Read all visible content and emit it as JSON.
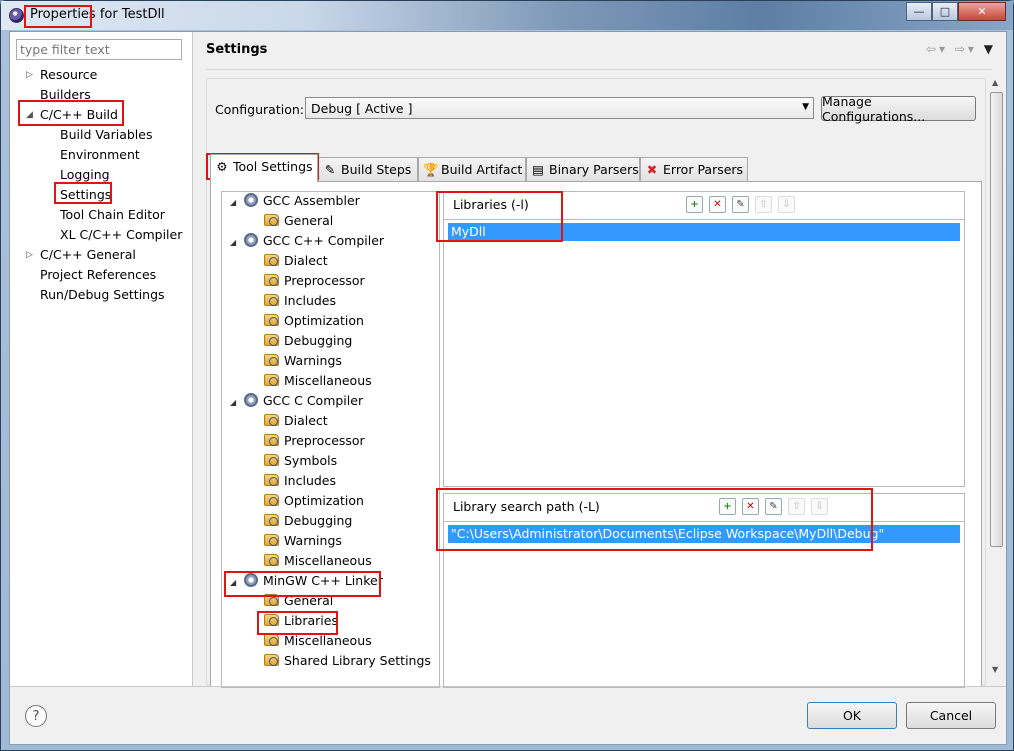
{
  "window": {
    "title": "Properties for TestDll",
    "controls": {
      "minimize": "—",
      "maximize": "□",
      "close": "✕"
    }
  },
  "left_tree": {
    "filter_placeholder": "type filter text",
    "items": [
      {
        "label": "Resource",
        "expander": "▷"
      },
      {
        "label": "Builders"
      },
      {
        "label": "C/C++ Build",
        "expander": "◢"
      },
      {
        "label": "Build Variables"
      },
      {
        "label": "Environment"
      },
      {
        "label": "Logging"
      },
      {
        "label": "Settings"
      },
      {
        "label": "Tool Chain Editor"
      },
      {
        "label": "XL C/C++ Compiler"
      },
      {
        "label": "C/C++ General",
        "expander": "▷"
      },
      {
        "label": "Project References"
      },
      {
        "label": "Run/Debug Settings"
      }
    ]
  },
  "header": {
    "title": "Settings",
    "nav_icons": {
      "back": "⇦",
      "menu1": "▾",
      "forward": "⇨",
      "menu2": "▾",
      "view_menu": "▼"
    }
  },
  "configuration": {
    "label": "Configuration:",
    "value": "Debug  [ Active ]",
    "manage_button": "Manage Configurations..."
  },
  "tabs": [
    {
      "label": "Tool Settings",
      "icon": "⚙"
    },
    {
      "label": "Build Steps",
      "icon": "✎"
    },
    {
      "label": "Build Artifact",
      "icon": "🏆"
    },
    {
      "label": "Binary Parsers",
      "icon": "▤"
    },
    {
      "label": "Error Parsers",
      "icon": "✖"
    }
  ],
  "tool_tree": {
    "groups": [
      {
        "label": "GCC Assembler",
        "children": [
          "General"
        ]
      },
      {
        "label": "GCC C++ Compiler",
        "children": [
          "Dialect",
          "Preprocessor",
          "Includes",
          "Optimization",
          "Debugging",
          "Warnings",
          "Miscellaneous"
        ]
      },
      {
        "label": "GCC C Compiler",
        "children": [
          "Dialect",
          "Preprocessor",
          "Symbols",
          "Includes",
          "Optimization",
          "Debugging",
          "Warnings",
          "Miscellaneous"
        ]
      },
      {
        "label": "MinGW C++ Linker",
        "children": [
          "General",
          "Libraries",
          "Miscellaneous",
          "Shared Library Settings"
        ]
      }
    ],
    "expander": "◢"
  },
  "libraries": {
    "title": "Libraries (-l)",
    "items": [
      "MyDll"
    ]
  },
  "library_search_path": {
    "title": "Library search path (-L)",
    "items": [
      "\"C:\\Users\\Administrator\\Documents\\Eclipse Workspace\\MyDll\\Debug\""
    ]
  },
  "list_toolbar": {
    "add": "+",
    "delete": "✕",
    "edit": "✎",
    "up": "⇧",
    "down": "⇩"
  },
  "footer": {
    "help": "?",
    "ok": "OK",
    "cancel": "Cancel"
  }
}
